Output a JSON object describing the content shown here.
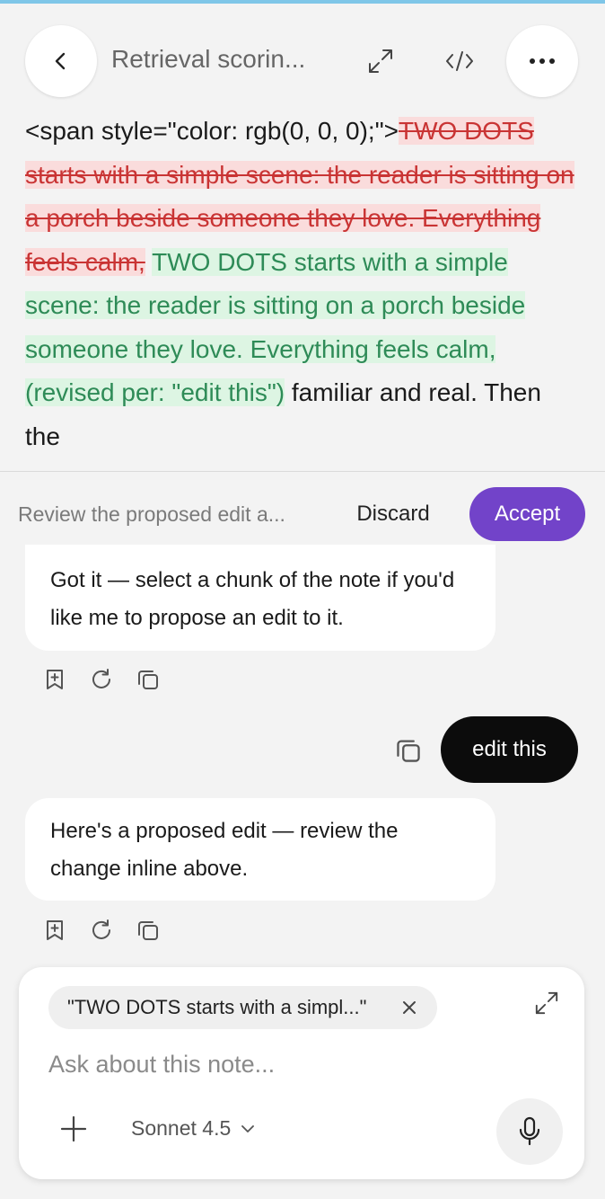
{
  "header": {
    "title": "Retrieval scorin...",
    "back_icon": "chevron-left-icon",
    "expand_icon": "expand-arrows-icon",
    "code_icon": "code-icon",
    "more_icon": "more-dots-icon"
  },
  "note": {
    "prefix": "<span style=\"color: rgb(0, 0, 0);\">",
    "deleted_text": "TWO DOTS starts with a simple scene: the reader is sitting on a porch beside someone they love. Everything feels calm,",
    "inserted_text": "TWO DOTS starts with a simple scene: the reader is sitting on a porch beside someone they love. Everything feels calm, (revised per: \"edit this\")",
    "suffix": "familiar and real. Then the"
  },
  "review": {
    "label": "Review the proposed edit a...",
    "discard_label": "Discard",
    "accept_label": "Accept"
  },
  "chat": {
    "assistant_msg_1": "Got it — select a chunk of the note if you'd like me to propose an edit to it.",
    "user_msg": "edit this",
    "assistant_msg_2": "Here's a proposed edit — review the change inline above."
  },
  "composer": {
    "chip_text": "\"TWO DOTS starts with a simpl...\"",
    "placeholder": "Ask about this note...",
    "model_label": "Sonnet 4.5"
  },
  "colors": {
    "accent": "#7243c9",
    "deleted_bg": "#fadcdc",
    "deleted_text": "#c93434",
    "inserted_bg": "#ddf5e3",
    "inserted_text": "#2e8b57"
  }
}
